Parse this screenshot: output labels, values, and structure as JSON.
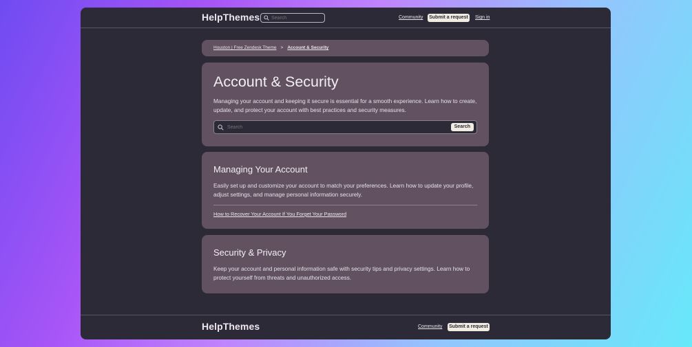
{
  "header": {
    "brand": "HelpThemes",
    "search_placeholder": "Search",
    "community_label": "Community",
    "submit_label": "Submit a request",
    "signin_label": "Sign in"
  },
  "breadcrumb": {
    "items": [
      "Houston | Free Zendesk Theme",
      "Account & Security"
    ],
    "separator": ">"
  },
  "hero": {
    "title": "Account & Security",
    "description": "Managing your account and keeping it secure is essential for a smooth experience. Learn how to create, update, and protect your account with best practices and security measures.",
    "search_placeholder": "Search",
    "search_button": "Search"
  },
  "sections": [
    {
      "title": "Managing Your Account",
      "description": "Easily set up and customize your account to match your preferences. Learn how to update your profile, adjust settings, and manage personal information securely.",
      "articles": [
        "How to Recover Your Account If You Forget Your Password"
      ]
    },
    {
      "title": "Security & Privacy",
      "description": "Keep your account and personal information safe with security tips and privacy settings. Learn how to protect yourself from threats and unauthorized access."
    }
  ],
  "footer": {
    "brand": "HelpThemes",
    "community_label": "Community",
    "submit_label": "Submit a request"
  },
  "colors": {
    "window_bg": "#2d2a37",
    "card_bg": "#625261",
    "button_bg": "#f1ece2"
  }
}
